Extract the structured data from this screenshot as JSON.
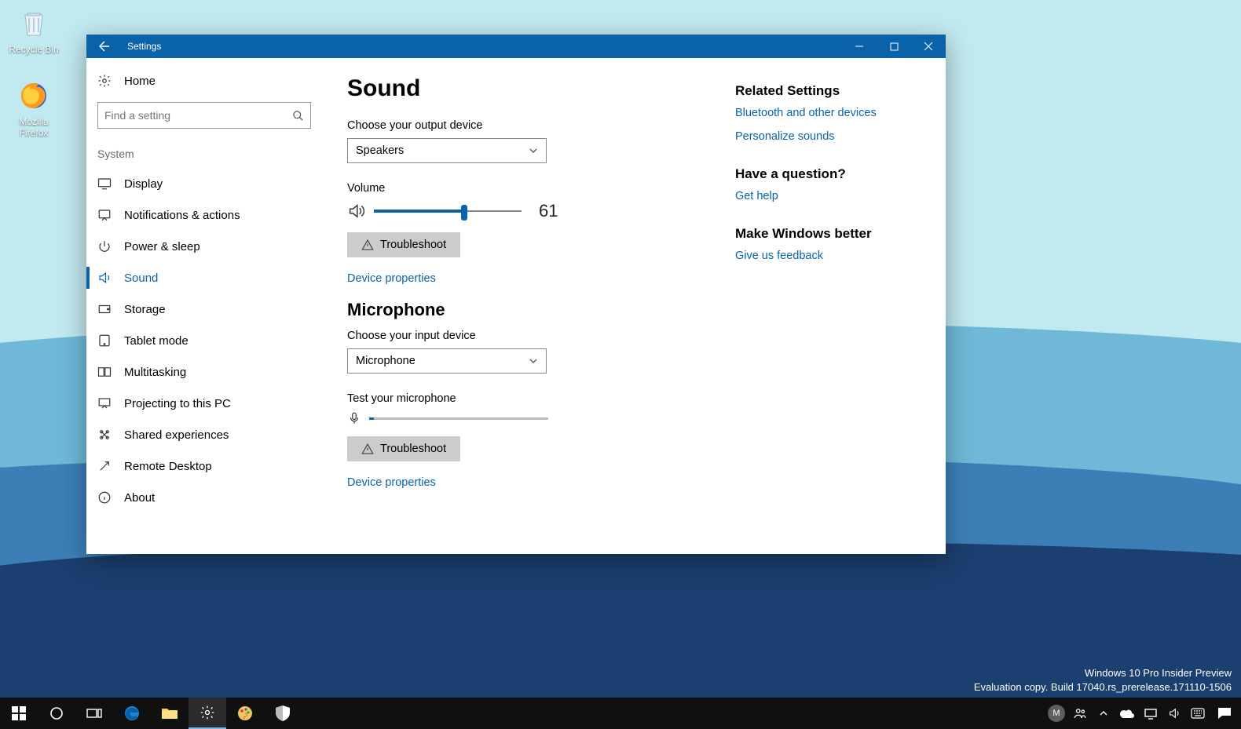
{
  "desktop_icons": {
    "recycle_bin": "Recycle Bin",
    "firefox": "Mozilla Firefox"
  },
  "window": {
    "title": "Settings"
  },
  "sidebar": {
    "home": "Home",
    "search_placeholder": "Find a setting",
    "group": "System",
    "items": [
      "Display",
      "Notifications & actions",
      "Power & sleep",
      "Sound",
      "Storage",
      "Tablet mode",
      "Multitasking",
      "Projecting to this PC",
      "Shared experiences",
      "Remote Desktop",
      "About"
    ],
    "selected_index": 3
  },
  "main": {
    "title": "Sound",
    "output": {
      "choose_label": "Choose your output device",
      "device": "Speakers",
      "volume_label": "Volume",
      "volume_value": "61",
      "volume_percent": 61,
      "troubleshoot": "Troubleshoot",
      "device_props": "Device properties"
    },
    "mic": {
      "heading": "Microphone",
      "choose_label": "Choose your input device",
      "device": "Microphone",
      "test_label": "Test your microphone",
      "troubleshoot": "Troubleshoot",
      "device_props": "Device properties"
    }
  },
  "right": {
    "related_h": "Related Settings",
    "related_links": [
      "Bluetooth and other devices",
      "Personalize sounds"
    ],
    "question_h": "Have a question?",
    "question_link": "Get help",
    "better_h": "Make Windows better",
    "better_link": "Give us feedback"
  },
  "watermark": {
    "l1": "Windows 10 Pro Insider Preview",
    "l2": "Evaluation copy. Build 17040.rs_prerelease.171110-1506"
  },
  "taskbar": {
    "avatar_letter": "M"
  }
}
